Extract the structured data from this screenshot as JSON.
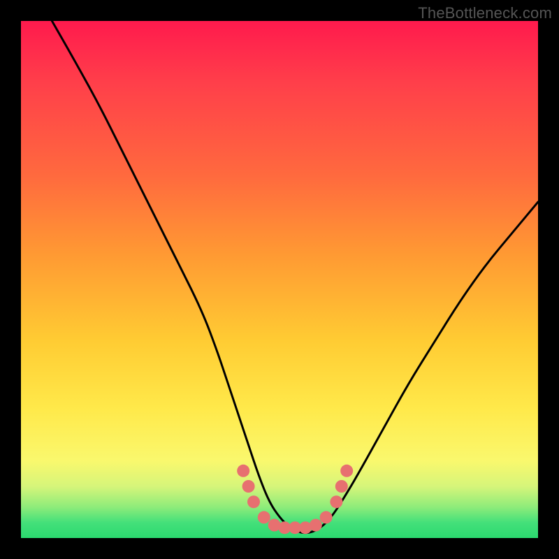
{
  "watermark": "TheBottleneck.com",
  "chart_data": {
    "type": "line",
    "title": "",
    "xlabel": "",
    "ylabel": "",
    "xlim": [
      0,
      100
    ],
    "ylim": [
      0,
      100
    ],
    "grid": false,
    "legend": false,
    "series": [
      {
        "name": "bottleneck-curve",
        "x": [
          6,
          10,
          15,
          20,
          25,
          30,
          35,
          38,
          40,
          42,
          44,
          46,
          48,
          50,
          52,
          54,
          56,
          58,
          60,
          62,
          65,
          70,
          75,
          80,
          85,
          90,
          95,
          100
        ],
        "y": [
          100,
          93,
          84,
          74,
          64,
          54,
          44,
          36,
          30,
          24,
          18,
          12,
          7,
          4,
          2,
          1,
          1,
          2,
          4,
          7,
          12,
          21,
          30,
          38,
          46,
          53,
          59,
          65
        ]
      },
      {
        "name": "highlight-dots",
        "type": "scatter",
        "points": [
          {
            "x": 43,
            "y": 13
          },
          {
            "x": 44,
            "y": 10
          },
          {
            "x": 45,
            "y": 7
          },
          {
            "x": 47,
            "y": 4
          },
          {
            "x": 49,
            "y": 2.5
          },
          {
            "x": 51,
            "y": 2
          },
          {
            "x": 53,
            "y": 2
          },
          {
            "x": 55,
            "y": 2
          },
          {
            "x": 57,
            "y": 2.5
          },
          {
            "x": 59,
            "y": 4
          },
          {
            "x": 61,
            "y": 7
          },
          {
            "x": 62,
            "y": 10
          },
          {
            "x": 63,
            "y": 13
          }
        ]
      }
    ],
    "colors": {
      "curve": "#000000",
      "dots": "#e77070",
      "gradient_top": "#ff1a4d",
      "gradient_bottom": "#2bd96f"
    }
  }
}
